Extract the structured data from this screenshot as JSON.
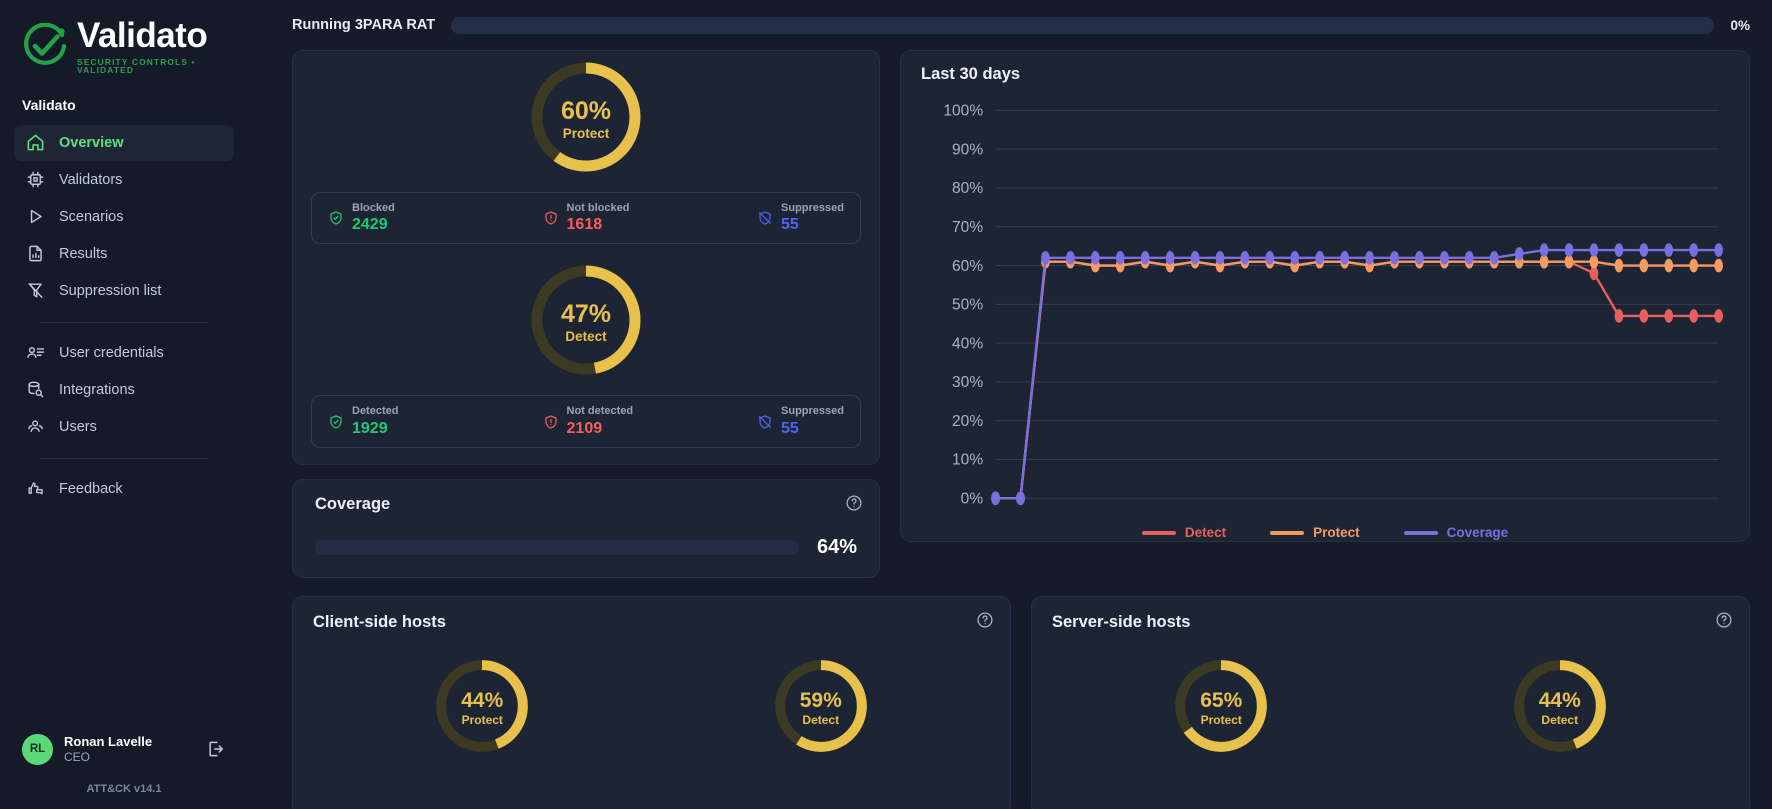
{
  "brand": {
    "name": "Validato",
    "tagline": "SECURITY CONTROLS • VALIDATED",
    "accent_green": "#2f9e52"
  },
  "sidebar": {
    "org_name": "Validato",
    "items": [
      {
        "label": "Overview",
        "icon": "home-icon",
        "active": true
      },
      {
        "label": "Validators",
        "icon": "chip-icon",
        "active": false
      },
      {
        "label": "Scenarios",
        "icon": "play-icon",
        "active": false
      },
      {
        "label": "Results",
        "icon": "report-icon",
        "active": false
      },
      {
        "label": "Suppression list",
        "icon": "filter-off-icon",
        "active": false
      }
    ],
    "items_secondary": [
      {
        "label": "User credentials",
        "icon": "id-card-icon"
      },
      {
        "label": "Integrations",
        "icon": "database-search-icon"
      },
      {
        "label": "Users",
        "icon": "users-icon"
      }
    ],
    "items_tertiary": [
      {
        "label": "Feedback",
        "icon": "thumbs-up-message-icon"
      }
    ],
    "profile": {
      "initials": "RL",
      "name": "Ronan Lavelle",
      "role": "CEO",
      "logout_icon": "logout-icon"
    },
    "footer_version": "ATT&CK v14.1"
  },
  "topbar": {
    "running_label": "Running 3PARA RAT",
    "progress_percent": 0,
    "progress_text": "0%"
  },
  "scores": {
    "protect": {
      "percent": 60,
      "percent_text": "60%",
      "name": "Protect",
      "stats": [
        {
          "label": "Blocked",
          "value": "2429",
          "icon": "shield-check-icon",
          "tone": "green"
        },
        {
          "label": "Not blocked",
          "value": "1618",
          "icon": "shield-alert-icon",
          "tone": "red"
        },
        {
          "label": "Suppressed",
          "value": "55",
          "icon": "shield-off-icon",
          "tone": "blue"
        }
      ]
    },
    "detect": {
      "percent": 47,
      "percent_text": "47%",
      "name": "Detect",
      "stats": [
        {
          "label": "Detected",
          "value": "1929",
          "icon": "shield-check-icon",
          "tone": "green"
        },
        {
          "label": "Not detected",
          "value": "2109",
          "icon": "shield-alert-icon",
          "tone": "red"
        },
        {
          "label": "Suppressed",
          "value": "55",
          "icon": "shield-off-icon",
          "tone": "blue"
        }
      ]
    }
  },
  "coverage": {
    "title": "Coverage",
    "percent": 64,
    "percent_text": "64%",
    "bar_color": "#9b87e8",
    "help_icon": "help-circle-icon"
  },
  "client_hosts": {
    "title": "Client-side hosts",
    "help_icon": "help-circle-icon",
    "donuts": [
      {
        "percent": 44,
        "percent_text": "44%",
        "name": "Protect"
      },
      {
        "percent": 59,
        "percent_text": "59%",
        "name": "Detect"
      }
    ]
  },
  "server_hosts": {
    "title": "Server-side hosts",
    "help_icon": "help-circle-icon",
    "donuts": [
      {
        "percent": 65,
        "percent_text": "65%",
        "name": "Protect"
      },
      {
        "percent": 44,
        "percent_text": "44%",
        "name": "Detect"
      }
    ]
  },
  "chart_data": {
    "type": "line",
    "title": "Last 30 days",
    "xlabel": "",
    "ylabel": "",
    "ylim": [
      0,
      100
    ],
    "yticks": [
      0,
      10,
      20,
      30,
      40,
      50,
      60,
      70,
      80,
      90,
      100
    ],
    "ytick_labels": [
      "0%",
      "10%",
      "20%",
      "30%",
      "40%",
      "50%",
      "60%",
      "70%",
      "80%",
      "90%",
      "100%"
    ],
    "grid": true,
    "legend_position": "bottom",
    "x": [
      1,
      2,
      3,
      4,
      5,
      6,
      7,
      8,
      9,
      10,
      11,
      12,
      13,
      14,
      15,
      16,
      17,
      18,
      19,
      20,
      21,
      22,
      23,
      24,
      25,
      26,
      27,
      28,
      29,
      30
    ],
    "series": [
      {
        "name": "Detect",
        "color": "#e8605d",
        "values": [
          0,
          0,
          61,
          61,
          60,
          60,
          61,
          60,
          61,
          60,
          61,
          61,
          60,
          61,
          61,
          60,
          61,
          61,
          61,
          61,
          61,
          61,
          61,
          61,
          58,
          47,
          47,
          47,
          47,
          47
        ]
      },
      {
        "name": "Protect",
        "color": "#f89b61",
        "values": [
          0,
          0,
          61,
          61,
          60,
          60,
          61,
          60,
          61,
          60,
          61,
          61,
          60,
          61,
          61,
          60,
          61,
          61,
          61,
          61,
          61,
          61,
          61,
          61,
          61,
          60,
          60,
          60,
          60,
          60
        ]
      },
      {
        "name": "Coverage",
        "color": "#7b6fe0",
        "values": [
          0,
          0,
          62,
          62,
          62,
          62,
          62,
          62,
          62,
          62,
          62,
          62,
          62,
          62,
          62,
          62,
          62,
          62,
          62,
          62,
          62,
          63,
          64,
          64,
          64,
          64,
          64,
          64,
          64,
          64
        ]
      }
    ]
  },
  "colors": {
    "gold": "#e8c14d",
    "gold_track": "#3d3a23",
    "panel": "#1d2433",
    "page_bg": "#151b29"
  }
}
